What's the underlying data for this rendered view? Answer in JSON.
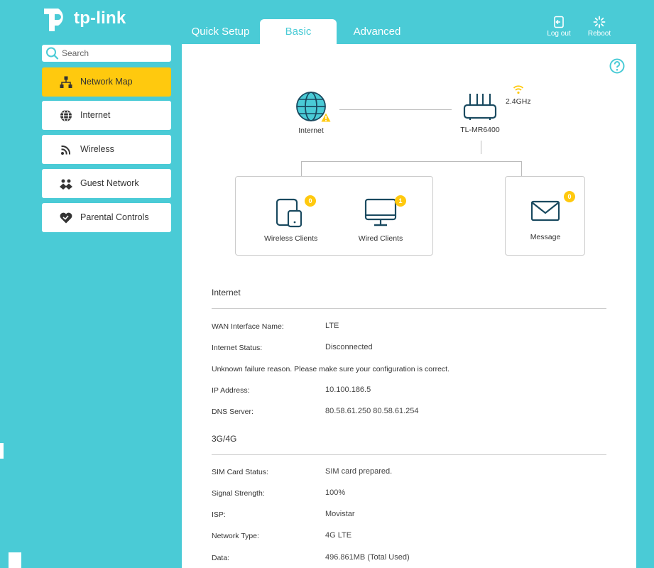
{
  "brand": {
    "name": "tp-link"
  },
  "colors": {
    "accent": "#4acbd6",
    "highlight": "#ffc90e",
    "icon": "#1a4a60"
  },
  "tabs": [
    {
      "label": "Quick Setup",
      "active": false
    },
    {
      "label": "Basic",
      "active": true
    },
    {
      "label": "Advanced",
      "active": false
    }
  ],
  "header": {
    "logout_label": "Log out",
    "reboot_label": "Reboot"
  },
  "search": {
    "placeholder": "Search"
  },
  "sidebar": {
    "items": [
      {
        "label": "Network Map",
        "icon": "network-map-icon",
        "active": true
      },
      {
        "label": "Internet",
        "icon": "globe-icon",
        "active": false
      },
      {
        "label": "Wireless",
        "icon": "wireless-icon",
        "active": false
      },
      {
        "label": "Guest Network",
        "icon": "guest-icon",
        "active": false
      },
      {
        "label": "Parental Controls",
        "icon": "heart-icon",
        "active": false
      }
    ]
  },
  "map": {
    "internet_label": "Internet",
    "router_label": "TL-MR6400",
    "band_label": "2.4GHz",
    "wireless_clients": {
      "label": "Wireless Clients",
      "count": "0"
    },
    "wired_clients": {
      "label": "Wired Clients",
      "count": "1"
    },
    "message": {
      "label": "Message",
      "count": "0"
    }
  },
  "internet": {
    "title": "Internet",
    "wan_label": "WAN Interface Name:",
    "wan_value": "LTE",
    "status_label": "Internet Status:",
    "status_value": "Disconnected",
    "note": "Unknown failure reason. Please make sure your configuration is correct.",
    "ip_label": "IP Address:",
    "ip_value": "10.100.186.5",
    "dns_label": "DNS Server:",
    "dns_value": "80.58.61.250 80.58.61.254"
  },
  "cellular": {
    "title": "3G/4G",
    "sim_label": "SIM Card Status:",
    "sim_value": "SIM card prepared.",
    "signal_label": "Signal Strength:",
    "signal_value": "100%",
    "isp_label": "ISP:",
    "isp_value": "Movistar",
    "type_label": "Network Type:",
    "type_value": "4G LTE",
    "data_label": "Data:",
    "data_value": "496.861MB (Total Used)"
  }
}
